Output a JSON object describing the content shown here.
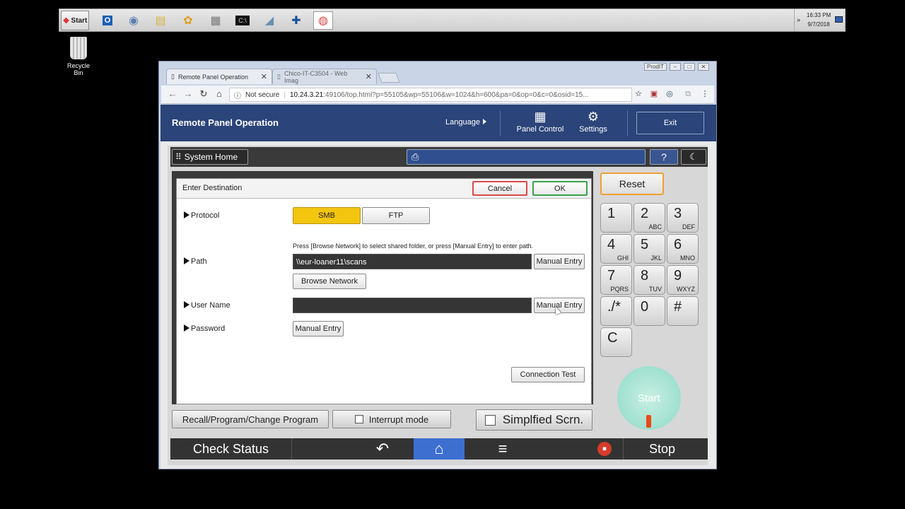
{
  "taskbar": {
    "start_label": "Start",
    "icons": [
      "outlook-icon",
      "control-panel-icon",
      "explorer-icon",
      "flower-icon",
      "calculator-icon",
      "cmd-icon",
      "pen-icon",
      "medic-icon",
      "chrome-icon"
    ],
    "time": "16:33 PM",
    "date": "9/7/2018"
  },
  "desktop": {
    "recycle_label": "Recycle Bin"
  },
  "browser": {
    "tabs": [
      {
        "title": "Remote Panel Operation",
        "active": true
      },
      {
        "title": "Chico-IT-C3504 - Web Imag",
        "active": false
      }
    ],
    "profile_label": "ProdIT",
    "security_label": "Not secure",
    "url_host": "10.24.3.21",
    "url_rest": ":49106/top.html?p=55105&wp=55106&w=1024&h=600&pa=0&op=0&c=0&osid=15..."
  },
  "rp": {
    "title": "Remote Panel Operation",
    "language": "Language",
    "panel_control": "Panel Control",
    "settings": "Settings",
    "exit": "Exit"
  },
  "panel": {
    "system_home": "System Home",
    "help": "?",
    "dialog": {
      "title": "Enter Destination",
      "cancel": "Cancel",
      "ok": "OK",
      "protocol_label": "Protocol",
      "smb": "SMB",
      "ftp": "FTP",
      "hint": "Press [Browse Network] to select shared folder, or press [Manual Entry] to enter path.",
      "path_label": "Path",
      "path_value": "\\\\eur-loaner11\\scans",
      "manual_entry": "Manual Entry",
      "browse_network": "Browse Network",
      "user_label": "User Name",
      "user_value": "",
      "password_label": "Password",
      "connection_test": "Connection Test"
    },
    "recall": "Recall/Program/Change Program",
    "interrupt": "Interrupt mode",
    "simplified": "Simplfied Scrn.",
    "reset": "Reset",
    "keys": [
      {
        "n": "1",
        "s": ""
      },
      {
        "n": "2",
        "s": "ABC"
      },
      {
        "n": "3",
        "s": "DEF"
      },
      {
        "n": "4",
        "s": "GHI"
      },
      {
        "n": "5",
        "s": "JKL"
      },
      {
        "n": "6",
        "s": "MNO"
      },
      {
        "n": "7",
        "s": "PQRS"
      },
      {
        "n": "8",
        "s": "TUV"
      },
      {
        "n": "9",
        "s": "WXYZ"
      },
      {
        "n": "./*",
        "s": ""
      },
      {
        "n": "0",
        "s": ""
      },
      {
        "n": "#",
        "s": ""
      },
      {
        "n": "C",
        "s": ""
      }
    ],
    "start": "Start",
    "check_status": "Check Status",
    "stop": "Stop"
  }
}
